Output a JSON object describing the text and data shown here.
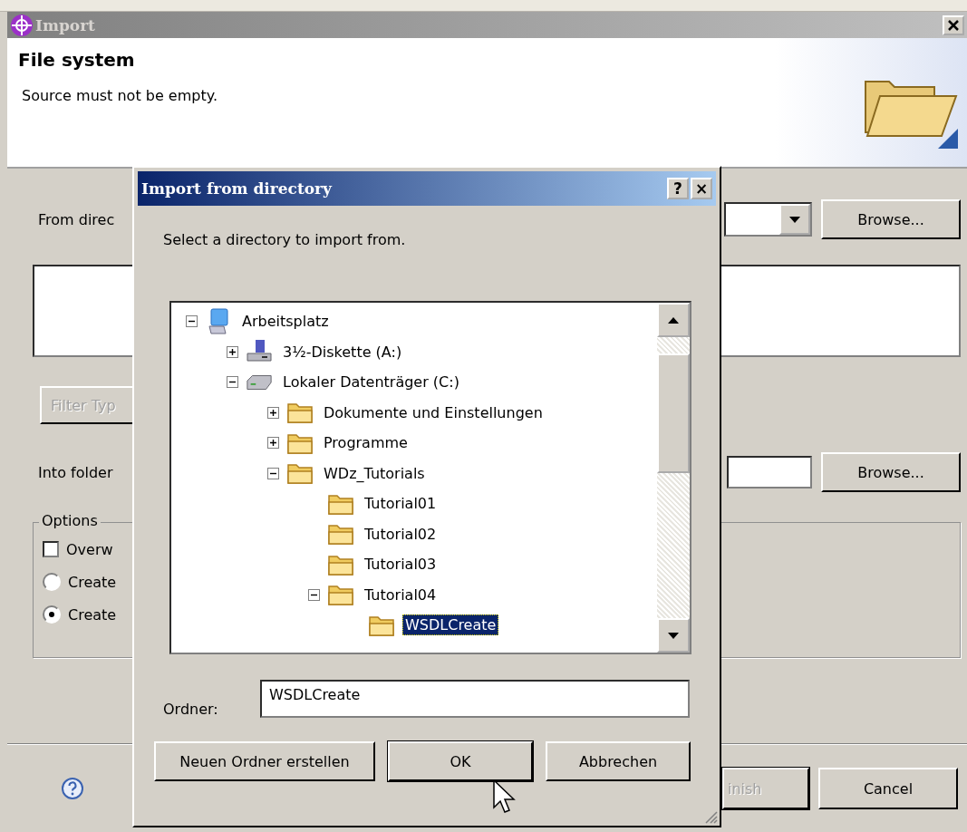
{
  "window": {
    "title": "Import"
  },
  "header": {
    "title": "File system",
    "message": "Source must not be empty."
  },
  "form": {
    "from_label": "From direc",
    "from_browse": "Browse...",
    "filter_button": {
      "label": "Filter Typ",
      "disabled": true
    },
    "into_label": "Into folder",
    "into_browse": "Browse...",
    "options": {
      "title": "Options",
      "items": [
        {
          "kind": "checkbox",
          "label": "Overw",
          "checked": false
        },
        {
          "kind": "radio",
          "label": "Create",
          "selected": false
        },
        {
          "kind": "radio",
          "label": "Create",
          "selected": true
        }
      ]
    }
  },
  "footer": {
    "finish": {
      "label": "inish",
      "disabled": true
    },
    "cancel": "Cancel"
  },
  "dialog": {
    "title": "Import from directory",
    "help": "?",
    "close": "×",
    "prompt": "Select a directory to import from.",
    "tree": [
      {
        "label": "Arbeitsplatz",
        "kind": "computer",
        "expanded": true,
        "selected": false,
        "children": [
          {
            "label": "3½-Diskette (A:)",
            "kind": "floppy",
            "expanded": false,
            "selected": false
          },
          {
            "label": "Lokaler Datenträger (C:)",
            "kind": "drive",
            "expanded": true,
            "selected": false,
            "children": [
              {
                "label": "Dokumente und Einstellungen",
                "kind": "folder",
                "expanded": false,
                "selected": false
              },
              {
                "label": "Programme",
                "kind": "folder",
                "expanded": false,
                "selected": false
              },
              {
                "label": "WDz_Tutorials",
                "kind": "folder",
                "expanded": true,
                "selected": false,
                "children": [
                  {
                    "label": "Tutorial01",
                    "kind": "folder",
                    "selected": false
                  },
                  {
                    "label": "Tutorial02",
                    "kind": "folder",
                    "selected": false
                  },
                  {
                    "label": "Tutorial03",
                    "kind": "folder",
                    "selected": false
                  },
                  {
                    "label": "Tutorial04",
                    "kind": "folder",
                    "expanded": true,
                    "selected": false,
                    "children": [
                      {
                        "label": "WSDLCreate",
                        "kind": "folder",
                        "selected": true
                      }
                    ]
                  }
                ]
              }
            ]
          }
        ]
      }
    ],
    "folder_label": "Ordner:",
    "folder_value": "WSDLCreate",
    "buttons": [
      {
        "label": "Neuen Ordner erstellen",
        "default": false
      },
      {
        "label": "OK",
        "default": true
      },
      {
        "label": "Abbrechen",
        "default": false
      }
    ]
  }
}
